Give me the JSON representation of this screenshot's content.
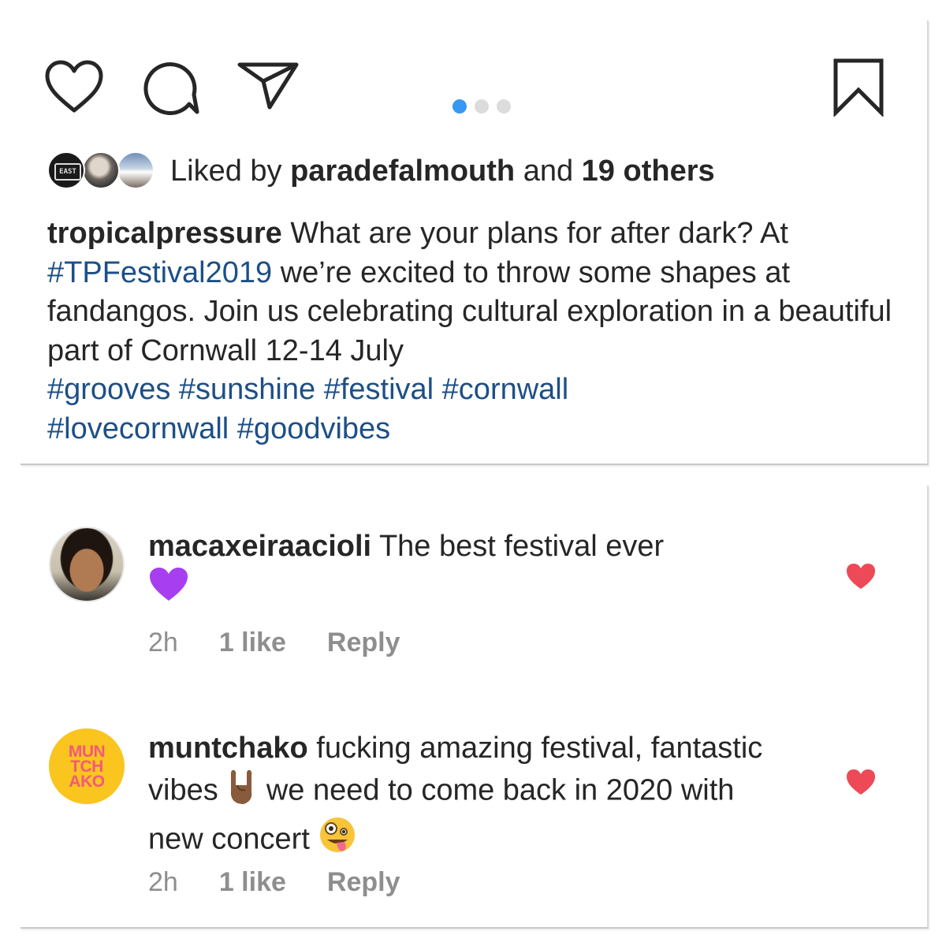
{
  "post": {
    "carousel": {
      "count": 3,
      "active_index": 0
    },
    "likes": {
      "prefix": "Liked by ",
      "user": "paradefalmouth",
      "middle": " and ",
      "others": "19 others",
      "avatar_1_text": "EAST"
    },
    "caption": {
      "username": "tropicalpressure",
      "text_1": " What are your plans for after dark? At ",
      "tag_1": "#TPFestival2019",
      "text_2": " we’re excited to throw some shapes at fandangos. Join us celebrating cultural exploration in a beautiful part of Cornwall 12-14 July ",
      "hashtags": [
        "#grooves",
        "#sunshine",
        "#festival",
        "#cornwall",
        "#lovecornwall",
        "#goodvibes"
      ]
    },
    "icons": [
      "heart-icon",
      "comment-icon",
      "share-icon",
      "bookmark-icon"
    ]
  },
  "comments": [
    {
      "username": "macaxeiraacioli",
      "text": " The best festival ever",
      "emoji_end": "purple-heart",
      "time": "2h",
      "likes": "1 like",
      "reply": "Reply",
      "liked": true
    },
    {
      "username": "muntchako",
      "text_1": " fucking amazing festival, fantastic vibes ",
      "emoji_1": "horns-hand",
      "text_2": " we need to come back in 2020 with new concert ",
      "emoji_2": "zany-face",
      "time": "2h",
      "likes": "1 like",
      "reply": "Reply",
      "liked": true,
      "avatar_text": [
        "MUN",
        "TCH",
        "AKO"
      ]
    }
  ],
  "colors": {
    "link": "#1d4f86",
    "heart_red": "#ed4956",
    "carousel_active": "#3897f0",
    "muted": "#8e8e8e",
    "brand_yellow": "#f9c51e",
    "brand_pink": "#f25a7a"
  }
}
